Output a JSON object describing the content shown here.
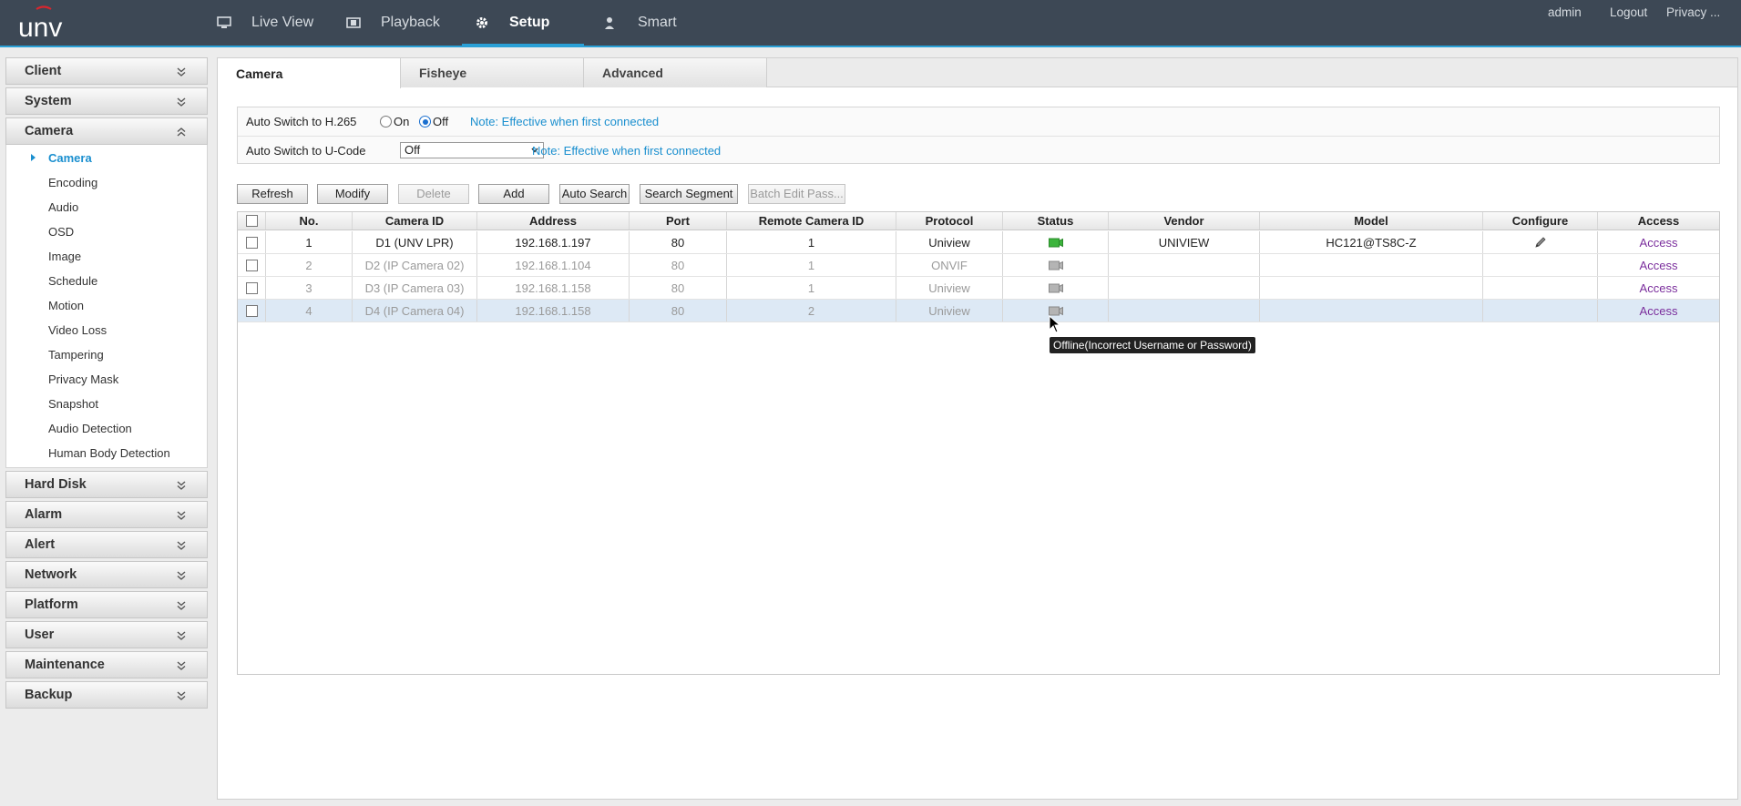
{
  "brand": {
    "logo_text": "unv",
    "accent_color": "#2aa0d6"
  },
  "topnav": {
    "items": [
      {
        "label": "Live View",
        "icon": "monitor-icon"
      },
      {
        "label": "Playback",
        "icon": "film-icon"
      },
      {
        "label": "Setup",
        "icon": "gear-icon",
        "active": true
      },
      {
        "label": "Smart",
        "icon": "person-icon"
      }
    ],
    "user": "admin",
    "logout": "Logout",
    "privacy": "Privacy ..."
  },
  "sidebar": {
    "sections": [
      {
        "label": "Client"
      },
      {
        "label": "System"
      },
      {
        "label": "Camera",
        "expanded": true
      },
      {
        "label": "Hard Disk"
      },
      {
        "label": "Alarm"
      },
      {
        "label": "Alert"
      },
      {
        "label": "Network"
      },
      {
        "label": "Platform"
      },
      {
        "label": "User"
      },
      {
        "label": "Maintenance"
      },
      {
        "label": "Backup"
      }
    ],
    "camera_items": [
      "Camera",
      "Encoding",
      "Audio",
      "OSD",
      "Image",
      "Schedule",
      "Motion",
      "Video Loss",
      "Tampering",
      "Privacy Mask",
      "Snapshot",
      "Audio Detection",
      "Human Body Detection"
    ],
    "active_item": "Camera"
  },
  "tabs": [
    {
      "label": "Camera",
      "active": true
    },
    {
      "label": "Fisheye"
    },
    {
      "label": "Advanced"
    }
  ],
  "settings": {
    "h265": {
      "label": "Auto Switch to H.265",
      "options": [
        "On",
        "Off"
      ],
      "selected": "Off",
      "note": "Note: Effective when first connected"
    },
    "ucode": {
      "label": "Auto Switch to U-Code",
      "value": "Off",
      "note": "Note: Effective when first connected"
    }
  },
  "toolbar": {
    "refresh": "Refresh",
    "modify": "Modify",
    "delete": "Delete",
    "add": "Add",
    "auto_search": "Auto Search",
    "search_segment": "Search Segment",
    "batch_edit": "Batch Edit Pass..."
  },
  "table": {
    "columns": [
      "No.",
      "Camera ID",
      "Address",
      "Port",
      "Remote Camera ID",
      "Protocol",
      "Status",
      "Vendor",
      "Model",
      "Configure",
      "Access"
    ],
    "rows": [
      {
        "no": "1",
        "camera_id": "D1 (UNV LPR)",
        "address": "192.168.1.197",
        "port": "80",
        "remote_id": "1",
        "protocol": "Uniview",
        "status": "online",
        "vendor": "UNIVIEW",
        "model": "HC121@TS8C-Z",
        "configure": true,
        "access": "Access"
      },
      {
        "no": "2",
        "camera_id": "D2 (IP Camera 02)",
        "address": "192.168.1.104",
        "port": "80",
        "remote_id": "1",
        "protocol": "ONVIF",
        "status": "offline",
        "vendor": "",
        "model": "",
        "configure": false,
        "access": "Access"
      },
      {
        "no": "3",
        "camera_id": "D3 (IP Camera 03)",
        "address": "192.168.1.158",
        "port": "80",
        "remote_id": "1",
        "protocol": "Uniview",
        "status": "offline",
        "vendor": "",
        "model": "",
        "configure": false,
        "access": "Access"
      },
      {
        "no": "4",
        "camera_id": "D4 (IP Camera 04)",
        "address": "192.168.1.158",
        "port": "80",
        "remote_id": "2",
        "protocol": "Uniview",
        "status": "offline",
        "vendor": "",
        "model": "",
        "configure": false,
        "access": "Access",
        "selected": true
      }
    ]
  },
  "tooltip": "Offline(Incorrect Username or Password)",
  "colors": {
    "online": "#3cb43c",
    "offline": "#9a9a9a",
    "link": "#1a8fcf",
    "access": "#7a2d9c"
  }
}
